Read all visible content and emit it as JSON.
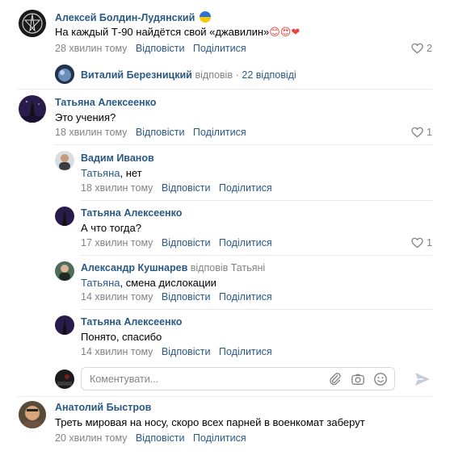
{
  "comments": [
    {
      "author": "Алексей Болдин-Лудянский",
      "flag_icon": "ukraine-flag-icon",
      "text": "На каждый Т-90 найдётся свой «джавилин»",
      "emoji": "😊😍❤",
      "time": "28 хвилин тому",
      "reply": "Відповісти",
      "share": "Поділитися",
      "likes": "2"
    },
    {
      "author": "Татьяна Алексеенко",
      "text": "Это учения?",
      "time": "18 хвилин тому",
      "reply": "Відповісти",
      "share": "Поділитися",
      "likes": "1"
    },
    {
      "author": "Анатолий Быстров",
      "text": "Треть мировая на носу, скоро всех парней в военкомат заберут",
      "time": "20 хвилин тому",
      "reply": "Відповісти",
      "share": "Поділитися"
    }
  ],
  "thread_preview": {
    "name": "Виталий Березницкий",
    "replied": "відповів",
    "sep": "·",
    "count": "22 відповіді"
  },
  "replies": [
    {
      "author": "Вадим Иванов",
      "mention": "Татьяна",
      "text": ", нет",
      "time": "18 хвилин тому",
      "reply": "Відповісти",
      "share": "Поділитися"
    },
    {
      "author": "Татьяна Алексеенко",
      "text": "А что тогда?",
      "time": "17 хвилин тому",
      "reply": "Відповісти",
      "share": "Поділитися",
      "likes": "1"
    },
    {
      "author": "Александр Кушнарев",
      "reply_to": "відповів Татьяні",
      "mention": "Татьяна",
      "text": ", смена дислокации",
      "time": "14 хвилин тому",
      "reply": "Відповісти",
      "share": "Поділитися"
    },
    {
      "author": "Татьяна Алексеенко",
      "text": "Понято, спасибо",
      "time": "14 хвилин тому",
      "reply": "Відповісти",
      "share": "Поділитися"
    }
  ],
  "composer": {
    "placeholder": "Коментувати..."
  },
  "colors": {
    "link": "#2a5885",
    "muted": "#828282",
    "divider": "#e7e8ec"
  }
}
